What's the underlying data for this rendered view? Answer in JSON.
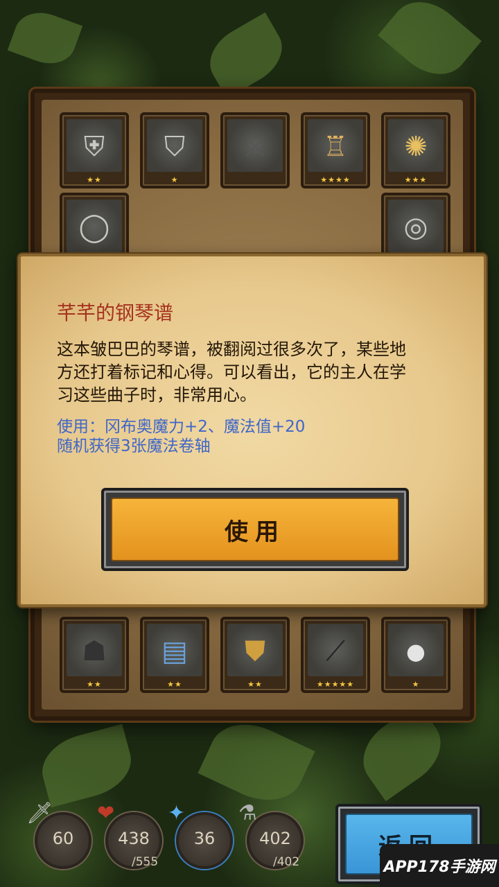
{
  "inventory": {
    "top_row": [
      {
        "icon": "shoulder-armor-icon",
        "glyph": "⛨",
        "stars": "★★"
      },
      {
        "icon": "chest-armor-icon",
        "glyph": "⛉",
        "stars": "★"
      },
      {
        "icon": "locked-slot-icon",
        "glyph": "⚔",
        "stars": ""
      },
      {
        "icon": "lantern-icon",
        "glyph": "♖",
        "stars": "★★★★"
      },
      {
        "icon": "amulet-icon",
        "glyph": "✺",
        "stars": "★★★"
      }
    ],
    "side_left": {
      "icon": "ring-band-icon",
      "glyph": "◯",
      "stars": "★"
    },
    "side_right": {
      "icon": "ring-icon",
      "glyph": "◎",
      "stars": ""
    },
    "bottom_row": [
      {
        "icon": "cloak-icon",
        "glyph": "☗",
        "stars": "★★"
      },
      {
        "icon": "card-icon",
        "glyph": "▤",
        "stars": "★★"
      },
      {
        "icon": "shield-icon",
        "glyph": "⛊",
        "stars": "★★"
      },
      {
        "icon": "wand-icon",
        "glyph": "⟋",
        "stars": "★★★★★"
      },
      {
        "icon": "pearl-icon",
        "glyph": "●",
        "stars": "★"
      }
    ]
  },
  "dialog": {
    "title": "芊芊的钢琴谱",
    "description": "这本皱巴巴的琴谱，被翻阅过很多次了，某些地方还打着标记和心得。可以看出，它的主人在学习这些曲子时，非常用心。",
    "effect_line1": "使用：冈布奥魔力+2、魔法值+20",
    "effect_line2": "随机获得3张魔法卷轴",
    "use_button": "使用"
  },
  "stats": [
    {
      "icon": "attack-icon",
      "glyph": "🗡",
      "value": "60",
      "max": ""
    },
    {
      "icon": "health-icon",
      "glyph": "❤",
      "value": "438",
      "max": "/555"
    },
    {
      "icon": "magic-power-icon",
      "glyph": "✦",
      "value": "36",
      "max": ""
    },
    {
      "icon": "mana-icon",
      "glyph": "⚗",
      "value": "402",
      "max": "/402"
    }
  ],
  "back_button": "返回",
  "watermark": "APP178手游网"
}
